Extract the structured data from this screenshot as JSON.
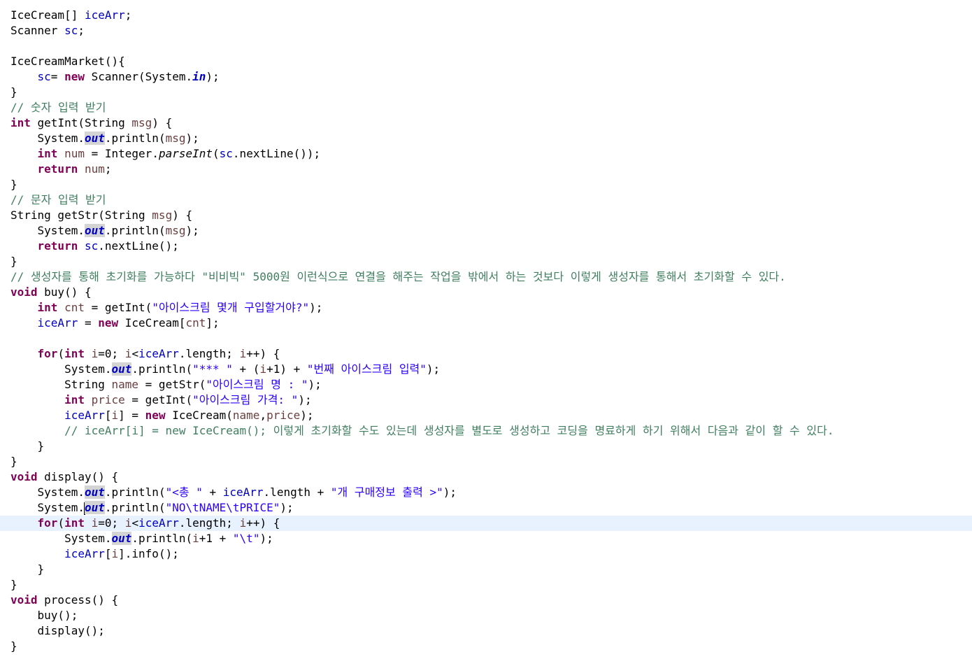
{
  "editor": {
    "language": "java",
    "current_line": 33,
    "lines": [
      [
        [
          "t",
          "IceCream[] "
        ],
        [
          "fld",
          "iceArr"
        ],
        [
          "t",
          ";"
        ]
      ],
      [
        [
          "t",
          "Scanner "
        ],
        [
          "fld",
          "sc"
        ],
        [
          "t",
          ";"
        ]
      ],
      [],
      [
        [
          "t",
          "IceCreamMarket(){"
        ]
      ],
      [
        [
          "t",
          "    "
        ],
        [
          "fld",
          "sc"
        ],
        [
          "t",
          "= "
        ],
        [
          "kw",
          "new"
        ],
        [
          "t",
          " Scanner(System."
        ],
        [
          "sfld",
          "in"
        ],
        [
          "t",
          ");"
        ]
      ],
      [
        [
          "t",
          "}"
        ]
      ],
      [
        [
          "cmt",
          "// 숫자 입력 받기"
        ]
      ],
      [
        [
          "kw",
          "int"
        ],
        [
          "t",
          " getInt(String "
        ],
        [
          "var",
          "msg"
        ],
        [
          "t",
          ") {"
        ]
      ],
      [
        [
          "t",
          "    System."
        ],
        [
          "sfldo",
          "out"
        ],
        [
          "t",
          ".println("
        ],
        [
          "var",
          "msg"
        ],
        [
          "t",
          ");"
        ]
      ],
      [
        [
          "t",
          "    "
        ],
        [
          "kw",
          "int"
        ],
        [
          "t",
          " "
        ],
        [
          "var",
          "num"
        ],
        [
          "t",
          " = Integer."
        ],
        [
          "smeth",
          "parseInt"
        ],
        [
          "t",
          "("
        ],
        [
          "fld",
          "sc"
        ],
        [
          "t",
          ".nextLine());"
        ]
      ],
      [
        [
          "t",
          "    "
        ],
        [
          "kw",
          "return"
        ],
        [
          "t",
          " "
        ],
        [
          "var",
          "num"
        ],
        [
          "t",
          ";"
        ]
      ],
      [
        [
          "t",
          "}"
        ]
      ],
      [
        [
          "cmt",
          "// 문자 입력 받기"
        ]
      ],
      [
        [
          "t",
          "String getStr(String "
        ],
        [
          "var",
          "msg"
        ],
        [
          "t",
          ") {"
        ]
      ],
      [
        [
          "t",
          "    System."
        ],
        [
          "sfldo",
          "out"
        ],
        [
          "t",
          ".println("
        ],
        [
          "var",
          "msg"
        ],
        [
          "t",
          ");"
        ]
      ],
      [
        [
          "t",
          "    "
        ],
        [
          "kw",
          "return"
        ],
        [
          "t",
          " "
        ],
        [
          "fld",
          "sc"
        ],
        [
          "t",
          ".nextLine();"
        ]
      ],
      [
        [
          "t",
          "}"
        ]
      ],
      [
        [
          "cmt",
          "// 생성자를 통해 초기화를 가능하다 \"비비빅\" 5000원 이런식으로 연결을 해주는 작업을 밖에서 하는 것보다 이렇게 생성자를 통해서 초기화할 수 있다."
        ]
      ],
      [
        [
          "kw",
          "void"
        ],
        [
          "t",
          " buy() {"
        ]
      ],
      [
        [
          "t",
          "    "
        ],
        [
          "kw",
          "int"
        ],
        [
          "t",
          " "
        ],
        [
          "var",
          "cnt"
        ],
        [
          "t",
          " = getInt("
        ],
        [
          "str",
          "\"아이스크림 몇개 구입할거야?\""
        ],
        [
          "t",
          ");"
        ]
      ],
      [
        [
          "t",
          "    "
        ],
        [
          "fld",
          "iceArr"
        ],
        [
          "t",
          " = "
        ],
        [
          "kw",
          "new"
        ],
        [
          "t",
          " IceCream["
        ],
        [
          "var",
          "cnt"
        ],
        [
          "t",
          "];"
        ]
      ],
      [],
      [
        [
          "t",
          "    "
        ],
        [
          "kw",
          "for"
        ],
        [
          "t",
          "("
        ],
        [
          "kw",
          "int"
        ],
        [
          "t",
          " "
        ],
        [
          "var",
          "i"
        ],
        [
          "t",
          "=0; "
        ],
        [
          "var",
          "i"
        ],
        [
          "t",
          "<"
        ],
        [
          "fld",
          "iceArr"
        ],
        [
          "t",
          ".length; "
        ],
        [
          "var",
          "i"
        ],
        [
          "t",
          "++) {"
        ]
      ],
      [
        [
          "t",
          "        System."
        ],
        [
          "sfldo",
          "out"
        ],
        [
          "t",
          ".println("
        ],
        [
          "str",
          "\"*** \""
        ],
        [
          "t",
          " + ("
        ],
        [
          "var",
          "i"
        ],
        [
          "t",
          "+1) + "
        ],
        [
          "str",
          "\"번째 아이스크림 입력\""
        ],
        [
          "t",
          ");"
        ]
      ],
      [
        [
          "t",
          "        String "
        ],
        [
          "var",
          "name"
        ],
        [
          "t",
          " = getStr("
        ],
        [
          "str",
          "\"아이스크림 명 : \""
        ],
        [
          "t",
          ");"
        ]
      ],
      [
        [
          "t",
          "        "
        ],
        [
          "kw",
          "int"
        ],
        [
          "t",
          " "
        ],
        [
          "var",
          "price"
        ],
        [
          "t",
          " = getInt("
        ],
        [
          "str",
          "\"아이스크림 가격: \""
        ],
        [
          "t",
          ");"
        ]
      ],
      [
        [
          "t",
          "        "
        ],
        [
          "fld",
          "iceArr"
        ],
        [
          "t",
          "["
        ],
        [
          "var",
          "i"
        ],
        [
          "t",
          "] = "
        ],
        [
          "kw",
          "new"
        ],
        [
          "t",
          " IceCream("
        ],
        [
          "var",
          "name"
        ],
        [
          "t",
          ","
        ],
        [
          "var",
          "price"
        ],
        [
          "t",
          ");"
        ]
      ],
      [
        [
          "t",
          "        "
        ],
        [
          "cmt",
          "// iceArr[i] = new IceCream(); 이렇게 초기화할 수도 있는데 생성자를 별도로 생성하고 코딩을 명료하게 하기 위해서 다음과 같이 할 수 있다."
        ]
      ],
      [
        [
          "t",
          "    }"
        ]
      ],
      [
        [
          "t",
          "}"
        ]
      ],
      [
        [
          "kw",
          "void"
        ],
        [
          "t",
          " display() {"
        ]
      ],
      [
        [
          "t",
          "    System."
        ],
        [
          "sfldo",
          "out"
        ],
        [
          "t",
          ".println("
        ],
        [
          "str",
          "\"<총 \""
        ],
        [
          "t",
          " + "
        ],
        [
          "fld",
          "iceArr"
        ],
        [
          "t",
          ".length + "
        ],
        [
          "str",
          "\"개 구매정보 출력 >\""
        ],
        [
          "t",
          ");"
        ]
      ],
      [
        [
          "t",
          "    System."
        ],
        [
          "cursor",
          ""
        ],
        [
          "sfldo",
          "out"
        ],
        [
          "t",
          ".println("
        ],
        [
          "str",
          "\"NO\\tNAME\\tPRICE\""
        ],
        [
          "t",
          ");"
        ]
      ],
      [
        [
          "t",
          "    "
        ],
        [
          "kw",
          "for"
        ],
        [
          "t",
          "("
        ],
        [
          "kw",
          "int"
        ],
        [
          "t",
          " "
        ],
        [
          "var",
          "i"
        ],
        [
          "t",
          "=0; "
        ],
        [
          "var",
          "i"
        ],
        [
          "t",
          "<"
        ],
        [
          "fld",
          "iceArr"
        ],
        [
          "t",
          ".length; "
        ],
        [
          "var",
          "i"
        ],
        [
          "t",
          "++) {"
        ]
      ],
      [
        [
          "t",
          "        System."
        ],
        [
          "sfldo",
          "out"
        ],
        [
          "t",
          ".println("
        ],
        [
          "var",
          "i"
        ],
        [
          "t",
          "+1 + "
        ],
        [
          "str",
          "\"\\t\""
        ],
        [
          "t",
          ");"
        ]
      ],
      [
        [
          "t",
          "        "
        ],
        [
          "fld",
          "iceArr"
        ],
        [
          "t",
          "["
        ],
        [
          "var",
          "i"
        ],
        [
          "t",
          "].info();"
        ]
      ],
      [
        [
          "t",
          "    }"
        ]
      ],
      [
        [
          "t",
          "}"
        ]
      ],
      [
        [
          "kw",
          "void"
        ],
        [
          "t",
          " process() {"
        ]
      ],
      [
        [
          "t",
          "    buy();"
        ]
      ],
      [
        [
          "t",
          "    display();"
        ]
      ],
      [
        [
          "t",
          "}"
        ]
      ]
    ]
  },
  "colors": {
    "keyword": "#7f0055",
    "field": "#0000c0",
    "string": "#2a00ff",
    "comment": "#3f7f5f",
    "local_variable": "#6a3e3e",
    "current_line_highlight": "#e8f2fe",
    "occurrence_highlight": "#d4d4d4"
  }
}
